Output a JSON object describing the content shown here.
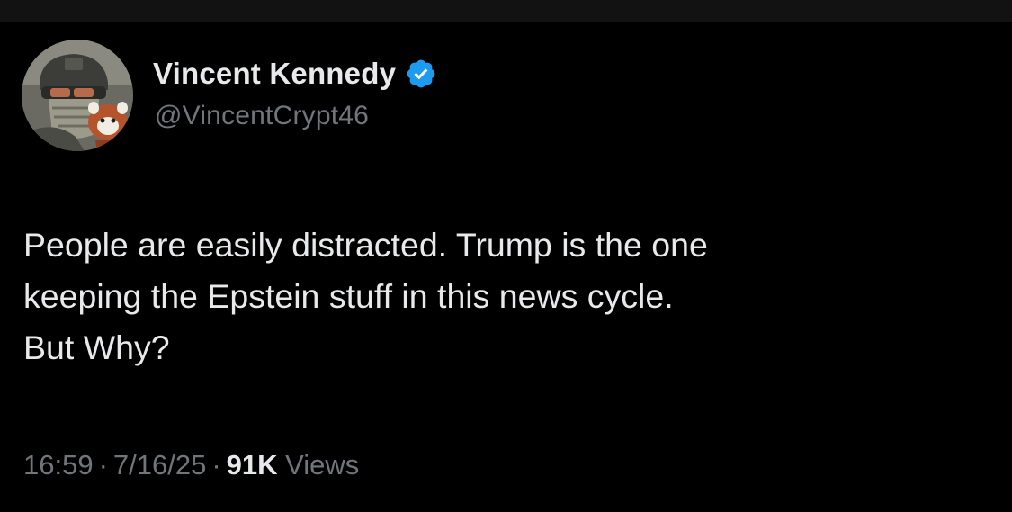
{
  "author": {
    "display_name": "Vincent Kennedy",
    "handle": "@VincentCrypt46",
    "verified_icon": "verified-badge-icon",
    "verified_color": "#1d9bf0"
  },
  "tweet": {
    "lines": [
      "People are easily distracted. Trump is the one",
      "keeping the Epstein stuff in this news cycle.",
      "But Why?"
    ]
  },
  "meta": {
    "time": "16:59",
    "separator": "·",
    "date": "7/16/25",
    "views_count": "91K",
    "views_label": "Views"
  },
  "colors": {
    "background": "#000000",
    "primary_text": "#e7e9ea",
    "secondary_text": "#71767b"
  }
}
